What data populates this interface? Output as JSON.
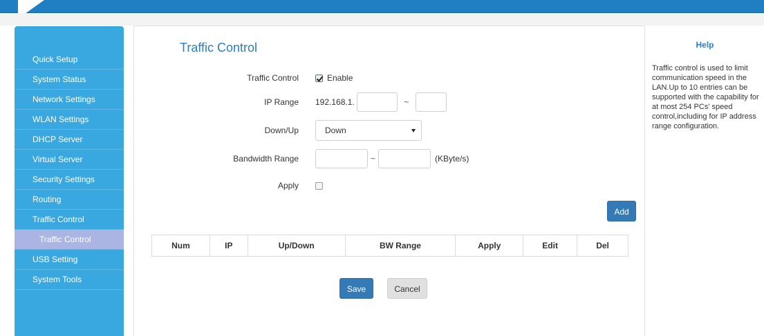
{
  "colors": {
    "header": "#1f7fc1",
    "sidebar": "#39a8e0",
    "sidebar_active": "#aab5e3",
    "accent": "#2a7ec4",
    "primary_button": "#337ab7"
  },
  "sidebar": {
    "items": [
      {
        "label": "Quick Setup"
      },
      {
        "label": "System Status"
      },
      {
        "label": "Network Settings"
      },
      {
        "label": "WLAN Settings"
      },
      {
        "label": "DHCP Server"
      },
      {
        "label": "Virtual Server"
      },
      {
        "label": "Security Settings"
      },
      {
        "label": "Routing"
      },
      {
        "label": "Traffic Control"
      },
      {
        "label": "Traffic Control",
        "active": true
      },
      {
        "label": "USB Setting"
      },
      {
        "label": "System Tools"
      }
    ]
  },
  "main": {
    "title": "Traffic Control",
    "form": {
      "traffic_control": {
        "label": "Traffic Control",
        "checkbox_label": "Enable",
        "checked": true
      },
      "ip_range": {
        "label": "IP Range",
        "prefix": "192.168.1.",
        "start_value": "",
        "separator": "~",
        "end_value": ""
      },
      "down_up": {
        "label": "Down/Up",
        "selected": "Down"
      },
      "bandwidth_range": {
        "label": "Bandwidth Range",
        "min_value": "",
        "separator": "~",
        "max_value": "",
        "unit": "(KByte/s)"
      },
      "apply": {
        "label": "Apply",
        "checked": false
      }
    },
    "add_button": "Add",
    "table": {
      "columns": [
        "Num",
        "IP",
        "Up/Down",
        "BW Range",
        "Apply",
        "Edit",
        "Del"
      ],
      "rows": []
    },
    "save_button": "Save",
    "cancel_button": "Cancel"
  },
  "help": {
    "title": "Help",
    "text": "Traffic control is used to limit communication speed in the LAN.Up to 10 entries can be supported with the capability for at most 254 PCs' speed control,including for IP address range configuration."
  }
}
